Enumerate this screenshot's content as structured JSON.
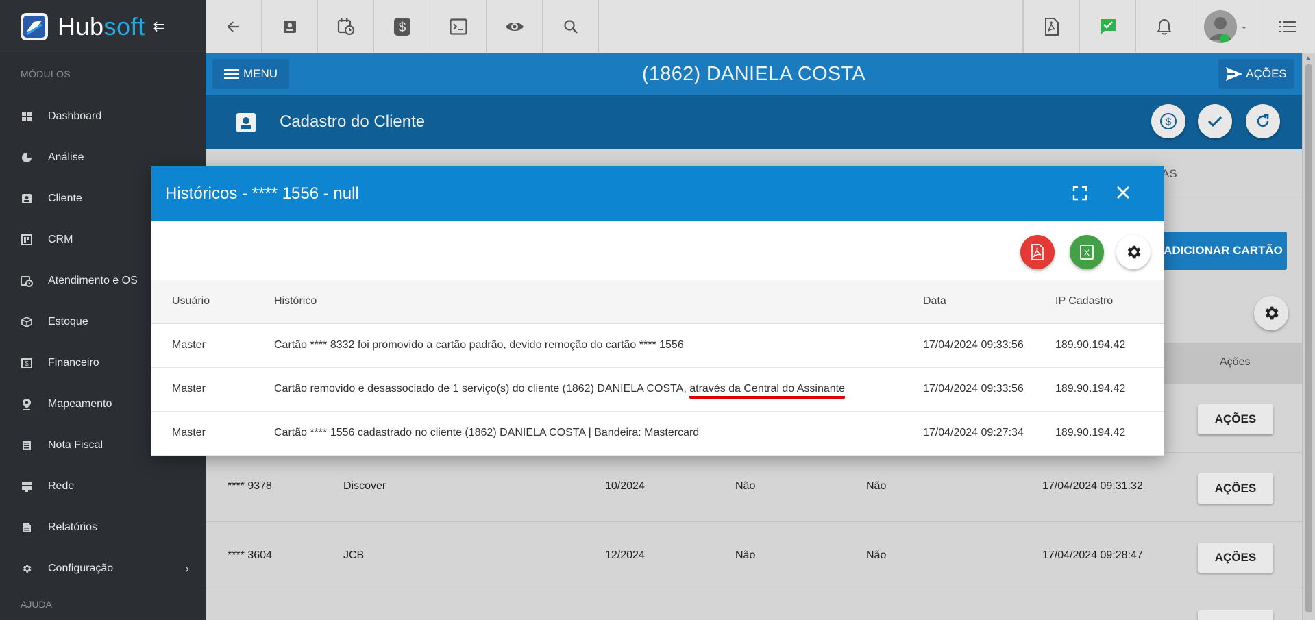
{
  "app": {
    "logo_hub": "Hub",
    "logo_soft": "soft"
  },
  "sidebar": {
    "section_modulos": "MÓDULOS",
    "items": [
      {
        "label": "Dashboard",
        "icon": "dashboard-icon"
      },
      {
        "label": "Análise",
        "icon": "pie-chart-icon"
      },
      {
        "label": "Cliente",
        "icon": "contact-card-icon"
      },
      {
        "label": "CRM",
        "icon": "crm-board-icon"
      },
      {
        "label": "Atendimento e OS",
        "icon": "calendar-clock-icon"
      },
      {
        "label": "Estoque",
        "icon": "box-icon"
      },
      {
        "label": "Financeiro",
        "icon": "money-icon"
      },
      {
        "label": "Mapeamento",
        "icon": "map-pin-icon"
      },
      {
        "label": "Nota Fiscal",
        "icon": "invoice-icon"
      },
      {
        "label": "Rede",
        "icon": "server-icon"
      },
      {
        "label": "Relatórios",
        "icon": "report-icon"
      },
      {
        "label": "Configuração",
        "icon": "gear-icon"
      }
    ],
    "section_ajuda": "AJUDA"
  },
  "header": {
    "menu_label": "MENU",
    "client_title": "(1862) DANIELA COSTA",
    "acoes_label": "AÇÕES",
    "page_title": "Cadastro do Cliente"
  },
  "background": {
    "tab_partial": "AS",
    "add_card_label": "ADICIONAR CARTÃO",
    "col_acoes": "Ações",
    "row_button": "AÇÕES",
    "rows": [
      {
        "card": "",
        "brand": "",
        "validity": "",
        "a": "",
        "b": "",
        "date": ""
      },
      {
        "card": "**** 9378",
        "brand": "Discover",
        "validity": "10/2024",
        "a": "Não",
        "b": "Não",
        "date": "17/04/2024 09:31:32"
      },
      {
        "card": "**** 3604",
        "brand": "JCB",
        "validity": "12/2024",
        "a": "Não",
        "b": "Não",
        "date": "17/04/2024 09:28:47"
      }
    ]
  },
  "modal": {
    "title": "Históricos - **** 1556 - null",
    "columns": [
      "Usuário",
      "Histórico",
      "Data",
      "IP Cadastro"
    ],
    "rows": [
      {
        "user": "Master",
        "history": "Cartão **** 8332 foi promovido a cartão padrão, devido remoção do cartão **** 1556",
        "history_tail": "",
        "date": "17/04/2024 09:33:56",
        "ip": "189.90.194.42"
      },
      {
        "user": "Master",
        "history": "Cartão removido e desassociado de 1 serviço(s) do cliente (1862) DANIELA COSTA,",
        "history_tail": "através da Central do Assinante",
        "date": "17/04/2024 09:33:56",
        "ip": "189.90.194.42"
      },
      {
        "user": "Master",
        "history": "Cartão **** 1556 cadastrado no cliente (1862) DANIELA COSTA | Bandeira: Mastercard",
        "history_tail": "",
        "date": "17/04/2024 09:27:34",
        "ip": "189.90.194.42"
      }
    ]
  },
  "colors": {
    "primary": "#1a7bbf",
    "modal_header": "#0d85d0",
    "sidebar": "#2b2e33",
    "pdf": "#e53935",
    "excel": "#43a047",
    "annotation": "#e00000"
  }
}
